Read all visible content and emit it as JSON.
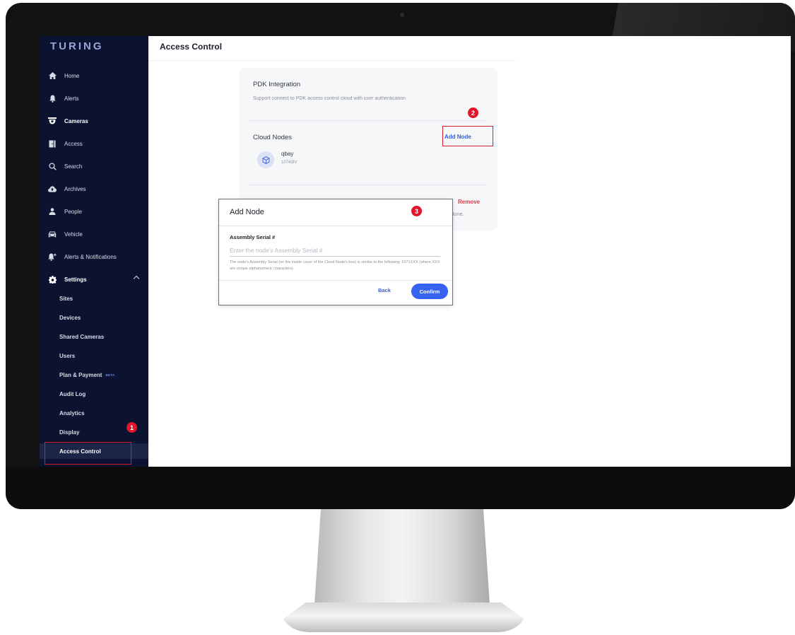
{
  "app": {
    "logo": "TURING",
    "page_title": "Access Control"
  },
  "sidebar": {
    "items": [
      {
        "label": "Home",
        "icon": "home-icon"
      },
      {
        "label": "Alerts",
        "icon": "bell-icon"
      },
      {
        "label": "Cameras",
        "icon": "camera-icon"
      },
      {
        "label": "Access",
        "icon": "door-icon"
      },
      {
        "label": "Search",
        "icon": "search-icon"
      },
      {
        "label": "Archives",
        "icon": "cloud-upload-icon"
      },
      {
        "label": "People",
        "icon": "person-icon"
      },
      {
        "label": "Vehicle",
        "icon": "car-icon"
      },
      {
        "label": "Alerts & Notifications",
        "icon": "bell-plus-icon"
      },
      {
        "label": "Settings",
        "icon": "gear-icon"
      }
    ],
    "settings_sub": [
      {
        "label": "Sites"
      },
      {
        "label": "Devices"
      },
      {
        "label": "Shared Cameras"
      },
      {
        "label": "Users"
      },
      {
        "label": "Plan & Payment",
        "badge": "BETA"
      },
      {
        "label": "Audit Log"
      },
      {
        "label": "Analytics"
      },
      {
        "label": "Display"
      },
      {
        "label": "Access Control"
      }
    ]
  },
  "pdk": {
    "title": "PDK Integration",
    "subtitle": "Support connect to PDK access control cloud with user authentication",
    "cloud_nodes_title": "Cloud Nodes",
    "add_node_label": "Add Node",
    "node": {
      "name": "qbay",
      "serial": "10743IV"
    },
    "remove_label": "Remove",
    "done_text": "done."
  },
  "modal": {
    "title": "Add Node",
    "field_label": "Assembly Serial #",
    "placeholder": "Enter the node's Assembly Serial #",
    "helper": "The node's Assembly Serial (on the inside cover of the Cloud Node's box) is similar to the following: 1071XXX (where XXX are unique alphanumeric characters).",
    "back_label": "Back",
    "confirm_label": "Confirm"
  },
  "markers": [
    "1",
    "2",
    "3"
  ],
  "colors": {
    "sidebar_bg": "#0b1331",
    "accent": "#3563f0",
    "marker_red": "#e0162b",
    "remove_red": "#e0364a"
  }
}
